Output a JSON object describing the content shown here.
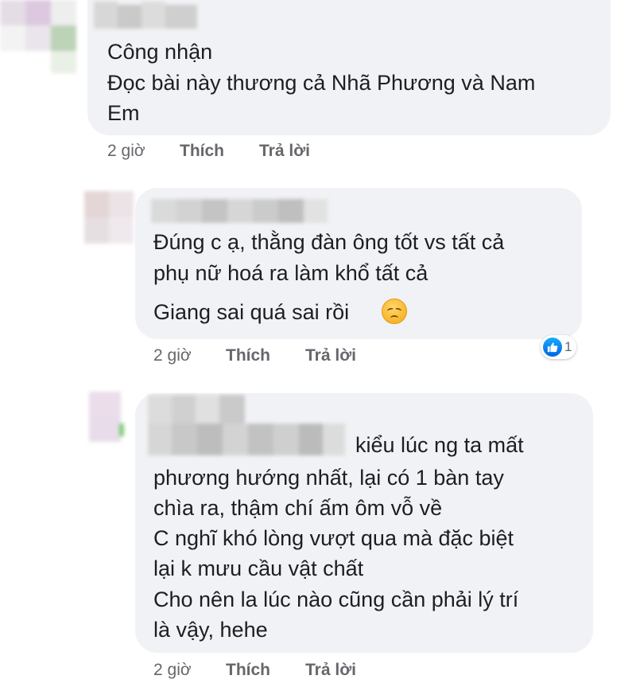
{
  "comments": [
    {
      "lines": [
        "Công nhận",
        "Đọc bài này thương cả Nhã Phương và Nam",
        "Em"
      ],
      "time": "2 giờ",
      "like_label": "Thích",
      "reply_label": "Trả lời"
    },
    {
      "lines": [
        "Đúng c ạ, thằng đàn ông tốt vs tất cả",
        "phụ nữ hoá ra làm khổ tất cả",
        "Giang sai quá sai rồi"
      ],
      "emoji": "disappointed-face",
      "time": "2 giờ",
      "like_label": "Thích",
      "reply_label": "Trả lời",
      "reaction": {
        "icon": "like-icon",
        "count": "1"
      }
    },
    {
      "lines": [
        "kiểu lúc ng ta mất",
        "phương hướng nhất, lại có 1 bàn tay",
        "chìa ra, thậm chí ấm ôm vỗ về",
        "C nghĩ khó lòng vượt qua mà đặc biệt",
        "lại k mưu cầu vật chất",
        "Cho nên la lúc nào cũng cần phải lý trí",
        "là vậy, hehe"
      ],
      "time": "2 giờ",
      "like_label": "Thích",
      "reply_label": "Trả lời"
    }
  ],
  "colors": {
    "bubble": "#f0f2f5",
    "meta_text": "#65676b",
    "like_blue": "#1877f2"
  }
}
